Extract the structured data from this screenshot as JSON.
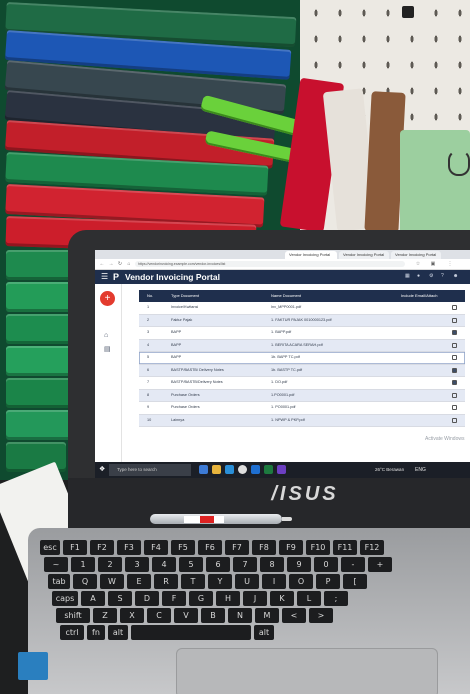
{
  "browser": {
    "tabs": [
      "Vendor Invoicing Portal",
      "Vendor Invoicing Portal",
      "Vendor Invoicing Portal"
    ],
    "address": "https://vendorinvoicing.example.com/vendor-invoices/list"
  },
  "app": {
    "title": "Vendor Invoicing Portal",
    "logo": "P"
  },
  "table": {
    "headers": [
      "No.",
      "Type Document",
      "Name Document",
      "Include Email/Attach"
    ],
    "rows": [
      {
        "no": "1",
        "type": "Invoice/Kwitansi",
        "name": "Inv_MPP0001.pdf",
        "checked": false
      },
      {
        "no": "2",
        "type": "Faktur Pajak",
        "name": "1. FAKTUR PAJAK 0010000123.pdf",
        "checked": false
      },
      {
        "no": "3",
        "type": "BAPP",
        "name": "1. BAPP.pdf",
        "checked": true
      },
      {
        "no": "4",
        "type": "BAPP",
        "name": "1. BERITA ACARA SERAH.pdf",
        "checked": false
      },
      {
        "no": "5",
        "type": "BAPP",
        "name": "1b. BAPP TC.pdf",
        "checked": false
      },
      {
        "no": "6",
        "type": "BASTP/BASTB/ Delivery Notes",
        "name": "1b. BASTP TC.pdf",
        "checked": true
      },
      {
        "no": "7",
        "type": "BASTP/BASTB/Delivery Notes",
        "name": "1. DO.pdf",
        "checked": true
      },
      {
        "no": "8",
        "type": "Purchase Orders",
        "name": "1.PO0001.pdf",
        "checked": false
      },
      {
        "no": "9",
        "type": "Purchase Orders",
        "name": "1. PO0001.pdf",
        "checked": false
      },
      {
        "no": "10",
        "type": "Lainnya",
        "name": "1. NPWP & PKP.pdf",
        "checked": false
      }
    ]
  },
  "watermark": "Activate Windows",
  "taskbar": {
    "search_placeholder": "Type here to search",
    "weather": "26°C Berawan",
    "tray": "ENG"
  },
  "laptop": {
    "brand": "/ISUS"
  },
  "keyboard": {
    "rows": [
      [
        "esc",
        "F1",
        "F2",
        "F3",
        "F4",
        "F5",
        "F6",
        "F7",
        "F8",
        "F9",
        "F10",
        "F11",
        "F12"
      ],
      [
        "~",
        "1",
        "2",
        "3",
        "4",
        "5",
        "6",
        "7",
        "8",
        "9",
        "0",
        "-",
        "+"
      ],
      [
        "tab",
        "Q",
        "W",
        "E",
        "R",
        "T",
        "Y",
        "U",
        "I",
        "O",
        "P",
        "["
      ],
      [
        "caps",
        "A",
        "S",
        "D",
        "F",
        "G",
        "H",
        "J",
        "K",
        "L",
        ";"
      ],
      [
        "shift",
        "Z",
        "X",
        "C",
        "V",
        "B",
        "N",
        "M",
        "<",
        ">"
      ],
      [
        "ctrl",
        "fn",
        "alt",
        "",
        "alt"
      ]
    ]
  }
}
